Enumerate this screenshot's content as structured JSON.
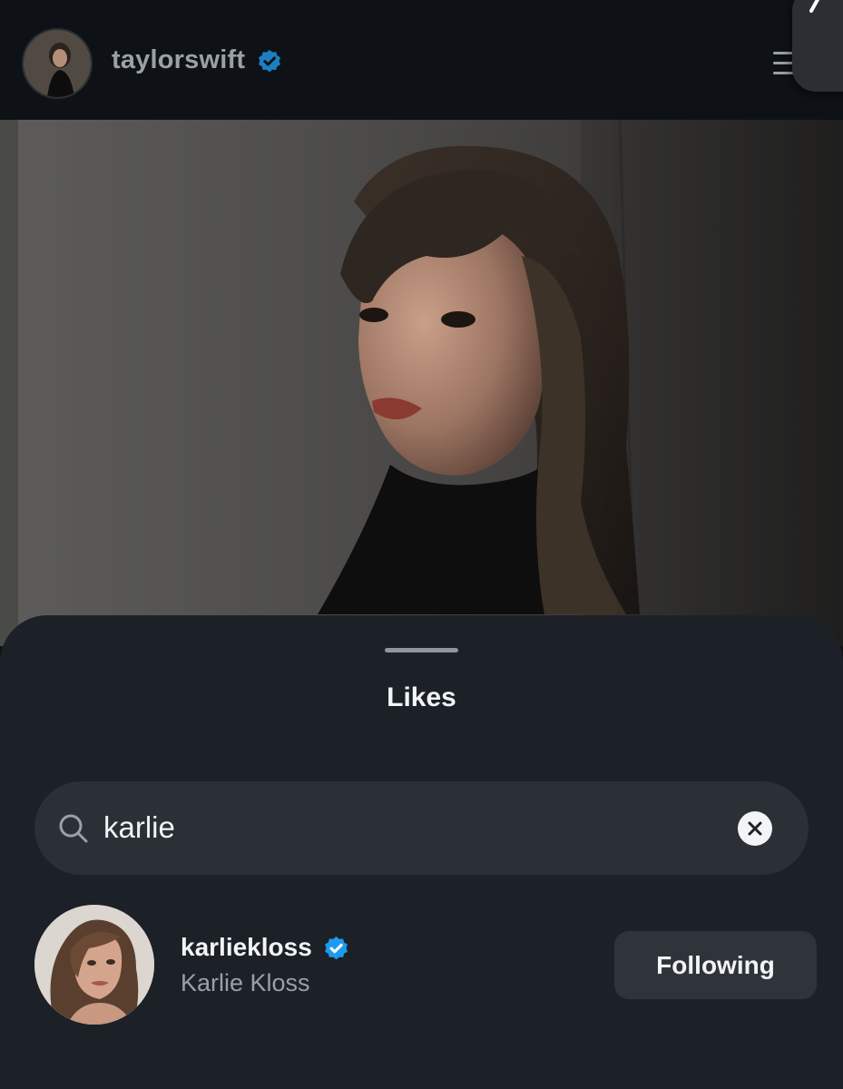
{
  "header": {
    "username": "taylorswift",
    "verified": true,
    "avatar_icon": "profile-photo"
  },
  "post": {
    "image_icon": "portrait-photo"
  },
  "likes_sheet": {
    "title": "Likes",
    "search": {
      "value": "karlie",
      "icon": "search-icon",
      "clear_icon": "clear-icon"
    },
    "results": [
      {
        "username": "karliekloss",
        "full_name": "Karlie Kloss",
        "verified": true,
        "button_label": "Following"
      }
    ]
  },
  "colors": {
    "background": "#0e1217",
    "sheet": "#1c2127",
    "verified_blue": "#1d9bf0",
    "search_field": "#2a3036",
    "button": "#2e343a"
  }
}
